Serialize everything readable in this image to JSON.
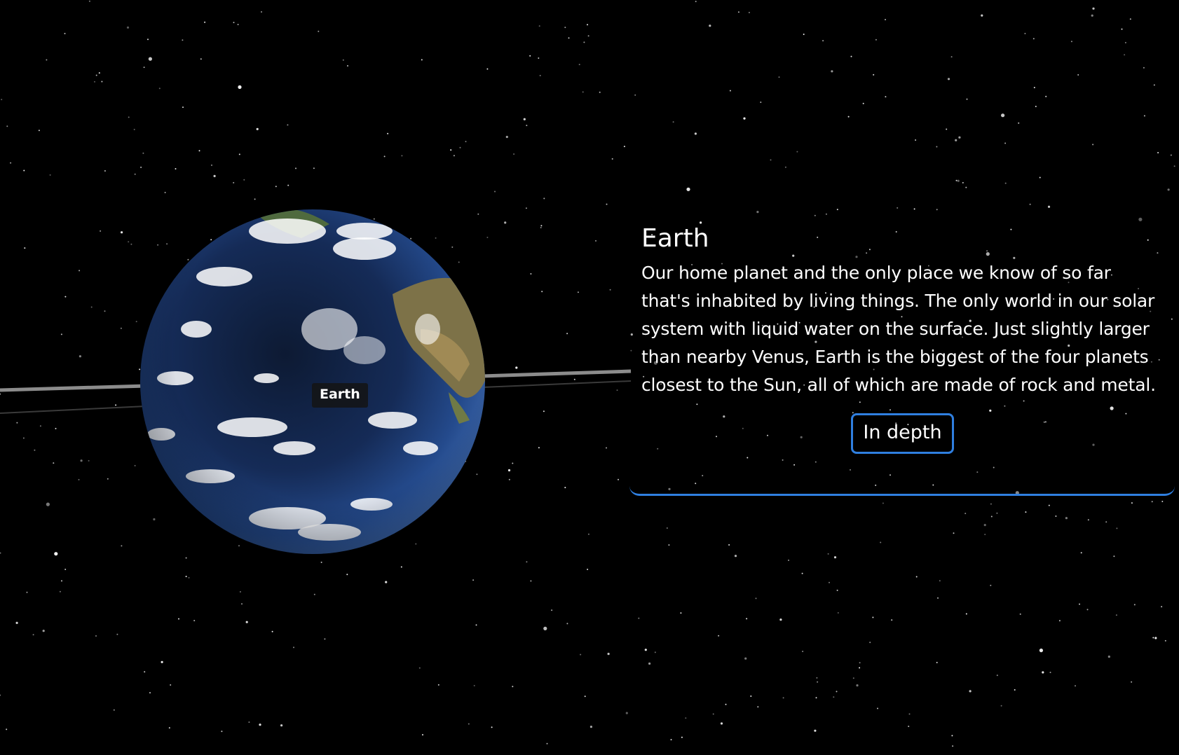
{
  "scene": {
    "planet_name": "Earth",
    "planet_label": "Earth"
  },
  "info_panel": {
    "title": "Earth",
    "description": "Our home planet and the only place we know of so far that's inhabited by living things. The only world in our solar system with liquid water on the surface. Just slightly larger than nearby Venus, Earth is the biggest of the four planets closest to the Sun, all of which are made of rock and metal.",
    "button_label": "In depth"
  },
  "colors": {
    "background": "#000000",
    "accent": "#2f7fe0",
    "ocean": "#1d3d74",
    "land": "#8a7a4a",
    "clouds": "#ffffff"
  }
}
